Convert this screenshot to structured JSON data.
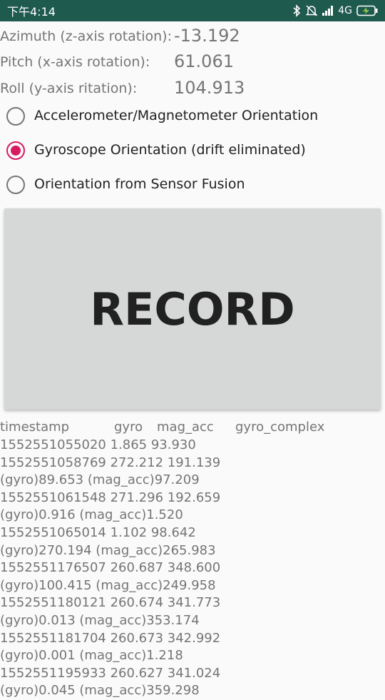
{
  "status_bar": {
    "time": "下午4:14",
    "network": "4G",
    "icons": [
      "bluetooth-icon",
      "alarm-off-icon",
      "signal-icon",
      "battery-charging-icon"
    ]
  },
  "readouts": [
    {
      "label": "Azimuth (z-axis rotation):",
      "value": "-13.192"
    },
    {
      "label": "Pitch (x-axis rotation):",
      "value": "61.061"
    },
    {
      "label": "Roll (y-axis ritation):",
      "value": "104.913"
    }
  ],
  "radio_options": [
    {
      "label": "Accelerometer/Magnetometer Orientation",
      "checked": false
    },
    {
      "label": "Gyroscope Orientation (drift eliminated)",
      "checked": true
    },
    {
      "label": "Orientation from Sensor Fusion",
      "checked": false
    }
  ],
  "record_button": {
    "label": "RECORD"
  },
  "log": {
    "columns": [
      "timestamp",
      "gyro",
      "mag_acc",
      "gyro_complex"
    ],
    "lines": [
      "1552551055020 1.865 93.930",
      "1552551058769 272.212 191.139",
      "(gyro)89.653 (mag_acc)97.209",
      "1552551061548 271.296 192.659",
      "(gyro)0.916 (mag_acc)1.520",
      "1552551065014 1.102 98.642",
      "(gyro)270.194 (mag_acc)265.983",
      "1552551176507 260.687 348.600",
      "(gyro)100.415 (mag_acc)249.958",
      "1552551180121 260.674 341.773",
      "(gyro)0.013 (mag_acc)353.174",
      "1552551181704 260.673 342.992",
      "(gyro)0.001 (mag_acc)1.218",
      "1552551195933 260.627 341.024",
      "(gyro)0.045 (mag_acc)359.298"
    ]
  },
  "colors": {
    "status_bar": "#1f5a4f",
    "accent": "#d81b60",
    "button_bg": "#d6d7d7",
    "secondary_text": "#757575",
    "primary_text": "#212121"
  }
}
